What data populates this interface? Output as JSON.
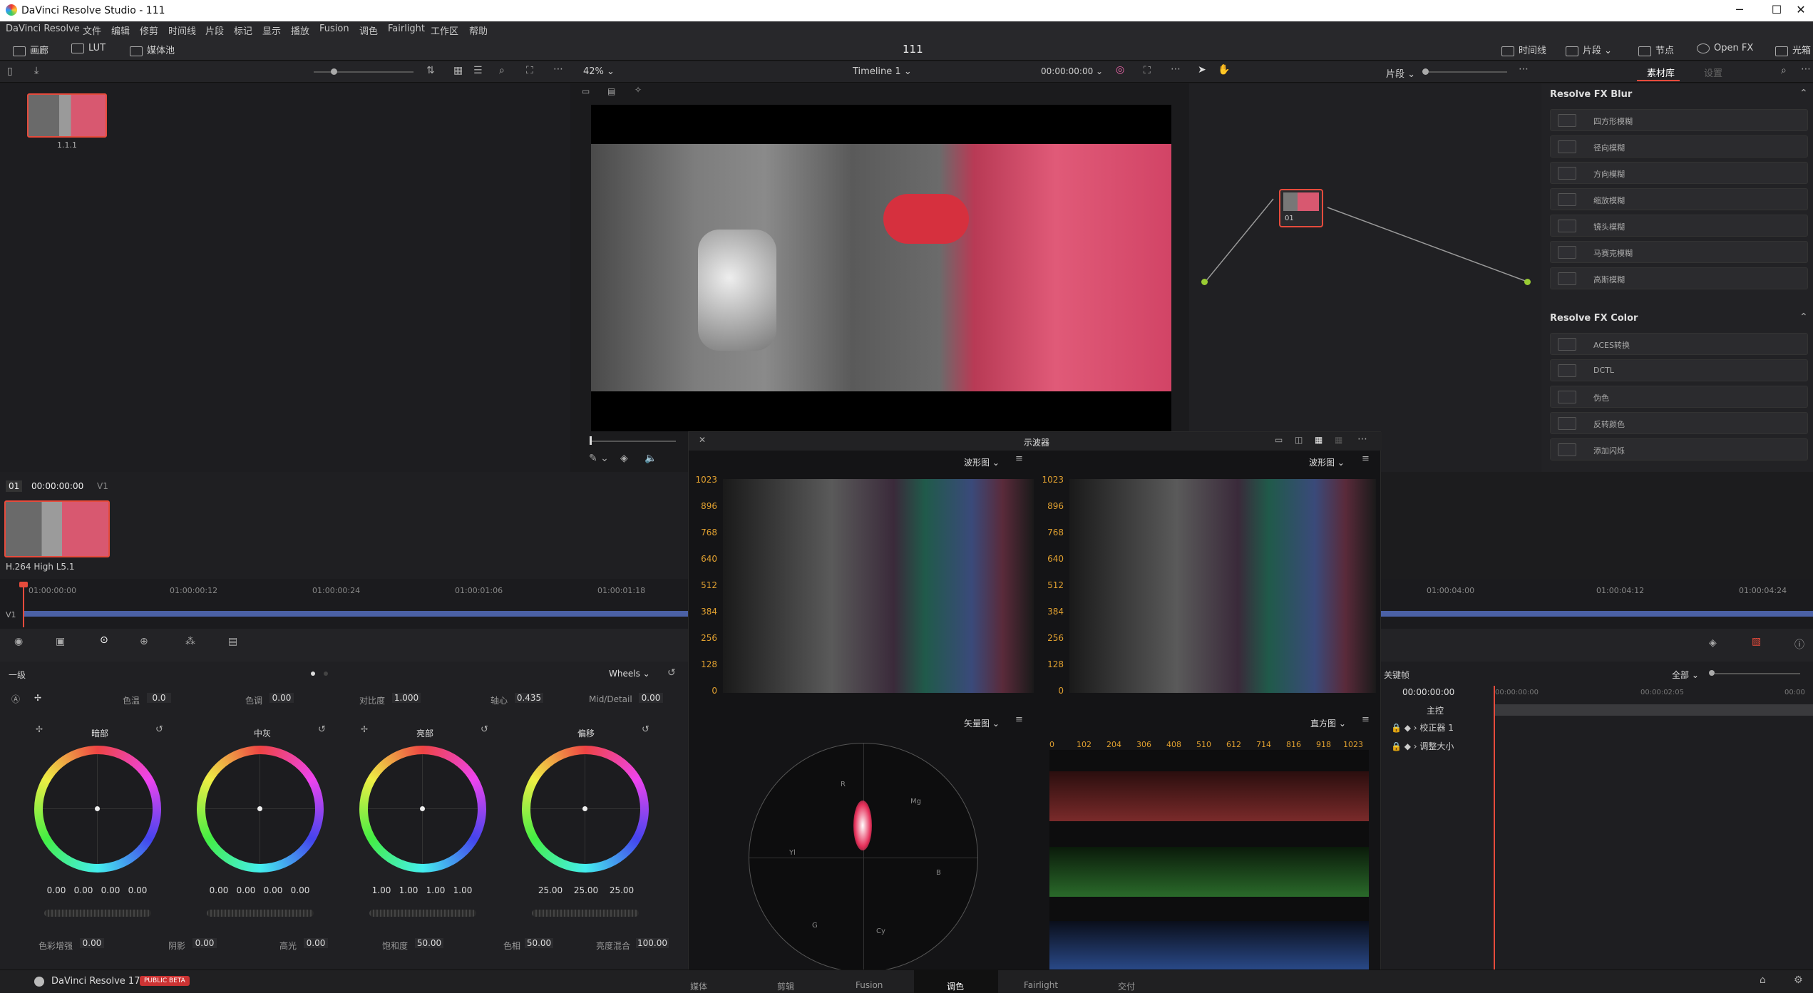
{
  "window": {
    "title": "DaVinci Resolve Studio - 111",
    "controls": [
      "─",
      "☐",
      "✕"
    ]
  },
  "menu": [
    "DaVinci Resolve",
    "文件",
    "编辑",
    "修剪",
    "时间线",
    "片段",
    "标记",
    "显示",
    "播放",
    "Fusion",
    "调色",
    "Fairlight",
    "工作区",
    "帮助"
  ],
  "topbar": {
    "left": [
      "画廊",
      "LUT",
      "媒体池"
    ],
    "project": "111",
    "right": [
      "时间线",
      "片段",
      "节点",
      "Open FX",
      "光箱"
    ]
  },
  "toolrow": {
    "zoom": "42%",
    "timeline_name": "Timeline 1",
    "timecode": "00:00:00:00",
    "clip_mode": "片段",
    "tabs": [
      "素材库",
      "设置"
    ]
  },
  "mediapool": {
    "thumb_label": "1.1.1"
  },
  "node": {
    "label": "01"
  },
  "fx": {
    "group1": "Resolve FX Blur",
    "blur_items": [
      "四方形模糊",
      "径向模糊",
      "方向模糊",
      "缩放模糊",
      "镜头模糊",
      "马赛克模糊",
      "高斯模糊"
    ],
    "group2": "Resolve FX Color",
    "color_items": [
      "ACES转换",
      "DCTL",
      "伪色",
      "反转颜色",
      "添加闪烁"
    ]
  },
  "clip": {
    "index": "01",
    "tc": "00:00:00:00",
    "track": "V1",
    "codec": "H.264 High L5.1"
  },
  "ruler": [
    "01:00:00:00",
    "01:00:00:12",
    "01:00:00:24",
    "01:00:01:06",
    "01:00:01:18"
  ],
  "ruler_right": [
    "01:00:04:00",
    "01:00:04:12",
    "01:00:04:24"
  ],
  "scopes": {
    "title": "示波器",
    "wf1": "波形图",
    "wf2": "波形图",
    "vec": "矢量图",
    "hist": "直方图",
    "yticks": [
      "1023",
      "896",
      "768",
      "640",
      "512",
      "384",
      "256",
      "128",
      "0"
    ],
    "hticks": [
      "0",
      "102",
      "204",
      "306",
      "408",
      "510",
      "612",
      "714",
      "816",
      "918",
      "1023"
    ],
    "vec_targets": [
      "R",
      "Mg",
      "B",
      "Cy",
      "G",
      "Yl"
    ]
  },
  "primaries": {
    "title": "一级",
    "mode": "Wheels",
    "temp_l": "色温",
    "temp": "0.0",
    "tint_l": "色调",
    "tint": "0.00",
    "contrast_l": "对比度",
    "contrast": "1.000",
    "pivot_l": "轴心",
    "pivot": "0.435",
    "md_l": "Mid/Detail",
    "md": "0.00",
    "wheels": [
      {
        "name": "暗部",
        "vals": [
          "0.00",
          "0.00",
          "0.00",
          "0.00"
        ]
      },
      {
        "name": "中灰",
        "vals": [
          "0.00",
          "0.00",
          "0.00",
          "0.00"
        ]
      },
      {
        "name": "亮部",
        "vals": [
          "1.00",
          "1.00",
          "1.00",
          "1.00"
        ]
      },
      {
        "name": "偏移",
        "vals": [
          "25.00",
          "25.00",
          "25.00"
        ]
      }
    ],
    "bottom": [
      [
        "色彩增强",
        "0.00"
      ],
      [
        "阴影",
        "0.00"
      ],
      [
        "高光",
        "0.00"
      ],
      [
        "饱和度",
        "50.00"
      ],
      [
        "色相",
        "50.00"
      ],
      [
        "亮度混合",
        "100.00"
      ]
    ]
  },
  "keyframes": {
    "title": "关键帧",
    "all": "全部",
    "tc": "00:00:00:00",
    "t1": "00:00:00:00",
    "t2": "00:00:02:05",
    "t3": "00:00",
    "rows": [
      "主控",
      "校正器 1",
      "调整大小"
    ]
  },
  "footer": {
    "app": "DaVinci Resolve 17",
    "badge": "PUBLIC BETA",
    "pages": [
      "媒体",
      "剪辑",
      "Fusion",
      "调色",
      "Fairlight",
      "交付"
    ]
  },
  "colors": {
    "accent": "#e64b3c",
    "track": "#4b61a6"
  }
}
